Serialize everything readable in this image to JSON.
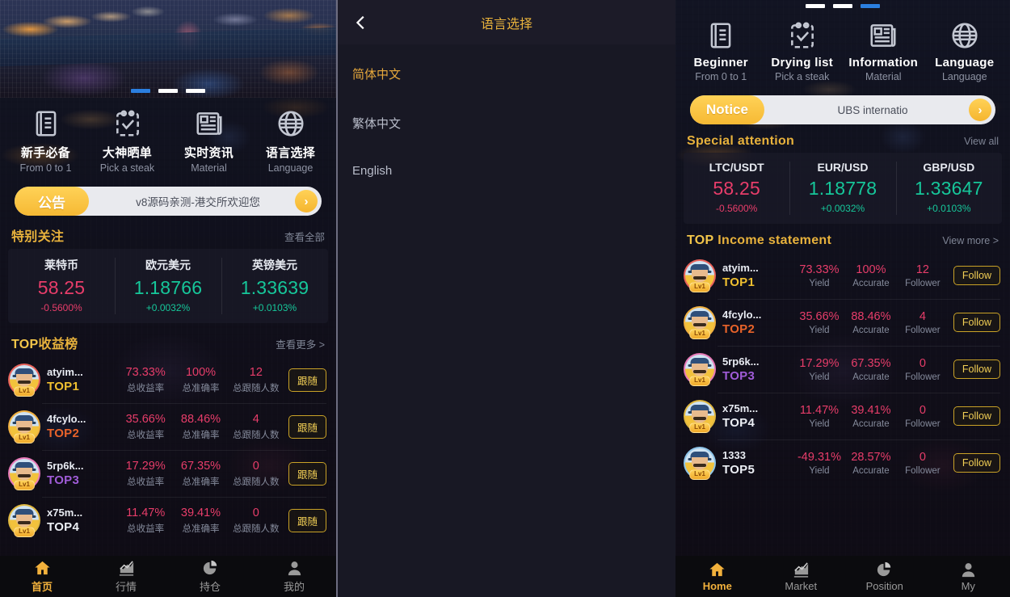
{
  "left_panel": {
    "carousel": {
      "dots": 3,
      "active_index": 0,
      "image_alt": "city-night-skyline"
    },
    "shortcuts": [
      {
        "icon": "book-icon",
        "title": "新手必备",
        "sub": "From 0 to 1"
      },
      {
        "icon": "checklist-icon",
        "title": "大神晒单",
        "sub": "Pick a steak"
      },
      {
        "icon": "news-icon",
        "title": "实时资讯",
        "sub": "Material"
      },
      {
        "icon": "globe-icon",
        "title": "语言选择",
        "sub": "Language"
      }
    ],
    "notice": {
      "tag": "公告",
      "text": "v8源码亲测-港交所欢迎您",
      "arrow": "›"
    },
    "special": {
      "title": "特别关注",
      "more": "查看全部"
    },
    "quotes": [
      {
        "name": "莱特币",
        "price": "58.25",
        "change": "-0.5600%",
        "dir": "down"
      },
      {
        "name": "欧元美元",
        "price": "1.18766",
        "change": "+0.0032%",
        "dir": "up"
      },
      {
        "name": "英镑美元",
        "price": "1.33639",
        "change": "+0.0103%",
        "dir": "up"
      }
    ],
    "rank_section": {
      "title_top": "TOP",
      "title_rest": "收益榜",
      "more": "查看更多 >"
    },
    "rank_labels": {
      "yield": "总收益率",
      "accurate": "总准确率",
      "follower": "总跟随人数",
      "follow_btn": "跟随",
      "level": "Lv1"
    },
    "ranks": [
      {
        "user": "atyim...",
        "badge": "TOP1",
        "badge_color": "#f0c030",
        "ring": "#e8625a",
        "yield": "73.33%",
        "accurate": "100%",
        "follower": "12"
      },
      {
        "user": "4fcylo...",
        "badge": "TOP2",
        "badge_color": "#e8632a",
        "ring": "#f0b040",
        "yield": "35.66%",
        "accurate": "88.46%",
        "follower": "4"
      },
      {
        "user": "5rp6k...",
        "badge": "TOP3",
        "badge_color": "#a05cd8",
        "ring": "#e87ab8",
        "yield": "17.29%",
        "accurate": "67.35%",
        "follower": "0"
      },
      {
        "user": "x75m...",
        "badge": "TOP4",
        "badge_color": "#eceff5",
        "ring": "#e0b840",
        "yield": "11.47%",
        "accurate": "39.41%",
        "follower": "0"
      }
    ],
    "tabs": [
      {
        "icon": "home-icon",
        "label": "首页",
        "active": true
      },
      {
        "icon": "chart-icon",
        "label": "行情",
        "active": false
      },
      {
        "icon": "pie-icon",
        "label": "持仓",
        "active": false
      },
      {
        "icon": "user-icon",
        "label": "我的",
        "active": false
      }
    ]
  },
  "mid_panel": {
    "header": {
      "title": "语言选择",
      "back_icon": "chevron-left-icon"
    },
    "languages": [
      {
        "label": "简体中文",
        "selected": true
      },
      {
        "label": "繁体中文",
        "selected": false
      },
      {
        "label": "English",
        "selected": false
      }
    ]
  },
  "right_panel": {
    "carousel": {
      "dots": 3,
      "active_index": 2
    },
    "shortcuts": [
      {
        "icon": "book-icon",
        "title": "Beginner",
        "sub": "From 0 to 1"
      },
      {
        "icon": "checklist-icon",
        "title": "Drying list",
        "sub": "Pick a steak"
      },
      {
        "icon": "news-icon",
        "title": "Information",
        "sub": "Material"
      },
      {
        "icon": "globe-icon",
        "title": "Language",
        "sub": "Language"
      }
    ],
    "notice": {
      "tag": "Notice",
      "text": "UBS internatio",
      "arrow": "›"
    },
    "special": {
      "title": "Special attention",
      "more": "View all"
    },
    "quotes": [
      {
        "name": "LTC/USDT",
        "price": "58.25",
        "change": "-0.5600%",
        "dir": "down"
      },
      {
        "name": "EUR/USD",
        "price": "1.18778",
        "change": "+0.0032%",
        "dir": "up"
      },
      {
        "name": "GBP/USD",
        "price": "1.33647",
        "change": "+0.0103%",
        "dir": "up"
      }
    ],
    "rank_section": {
      "title_top": "TOP",
      "title_rest": "Income statement",
      "more": "View more >"
    },
    "rank_labels": {
      "yield": "Yield",
      "accurate": "Accurate",
      "follower": "Follower",
      "follow_btn": "Follow",
      "level": "Lv1"
    },
    "ranks": [
      {
        "user": "atyim...",
        "badge": "TOP1",
        "badge_color": "#f0c030",
        "ring": "#e8625a",
        "yield": "73.33%",
        "accurate": "100%",
        "follower": "12"
      },
      {
        "user": "4fcylo...",
        "badge": "TOP2",
        "badge_color": "#e8632a",
        "ring": "#f0b040",
        "yield": "35.66%",
        "accurate": "88.46%",
        "follower": "4"
      },
      {
        "user": "5rp6k...",
        "badge": "TOP3",
        "badge_color": "#a05cd8",
        "ring": "#e87ab8",
        "yield": "17.29%",
        "accurate": "67.35%",
        "follower": "0"
      },
      {
        "user": "x75m...",
        "badge": "TOP4",
        "badge_color": "#eceff5",
        "ring": "#e0b840",
        "yield": "11.47%",
        "accurate": "39.41%",
        "follower": "0"
      },
      {
        "user": "1333",
        "badge": "TOP5",
        "badge_color": "#eceff5",
        "ring": "#8ec4e8",
        "yield": "-49.31%",
        "accurate": "28.57%",
        "follower": "0"
      }
    ],
    "tabs": [
      {
        "icon": "home-icon",
        "label": "Home",
        "active": true
      },
      {
        "icon": "chart-icon",
        "label": "Market",
        "active": false
      },
      {
        "icon": "pie-icon",
        "label": "Position",
        "active": false
      },
      {
        "icon": "user-icon",
        "label": "My",
        "active": false
      }
    ]
  },
  "colors": {
    "accent": "#e8b23c",
    "up": "#16c79a",
    "down": "#e83d6a",
    "notice": "#f6b934"
  }
}
